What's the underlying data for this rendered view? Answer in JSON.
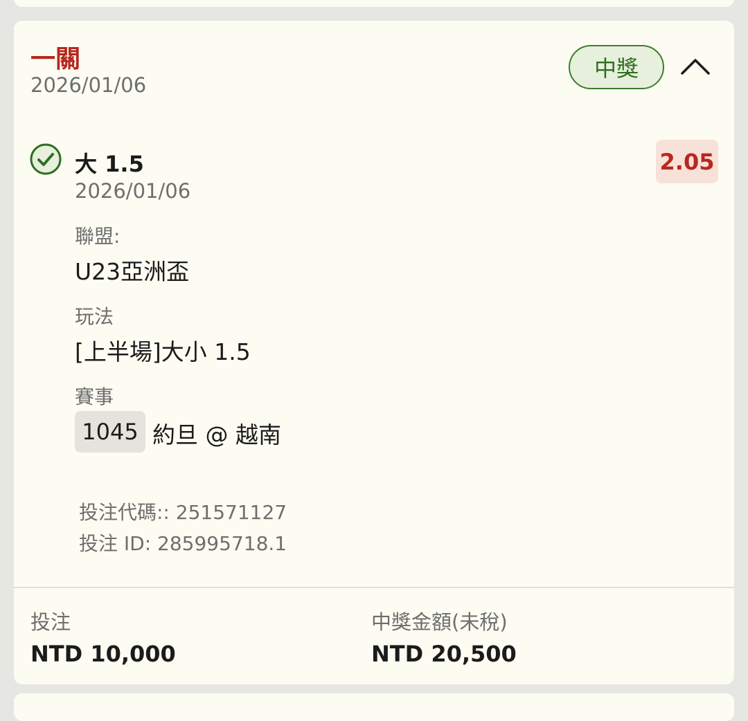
{
  "bet": {
    "type": "一關",
    "date": "2026/01/06",
    "status": "中獎",
    "status_color": "#2f6e22",
    "accent_color": "#b8271e"
  },
  "selection": {
    "name": "大 1.5",
    "odds": "2.05",
    "date": "2026/01/06",
    "league_label": "聯盟:",
    "league": "U23亞洲盃",
    "market_label": "玩法",
    "market": "[上半場]大小 1.5",
    "event_label": "賽事",
    "event_code": "1045",
    "event_name": "約旦 @ 越南"
  },
  "meta": {
    "bet_code": "投注代碼:: 251571127",
    "bet_id": "投注 ID: 285995718.1"
  },
  "summary": {
    "stake_label": "投注",
    "stake": "NTD 10,000",
    "payout_label": "中獎金額(未稅)",
    "payout": "NTD 20,500"
  },
  "icons": {
    "result": "check-circle-icon",
    "collapse": "chevron-up-icon"
  }
}
